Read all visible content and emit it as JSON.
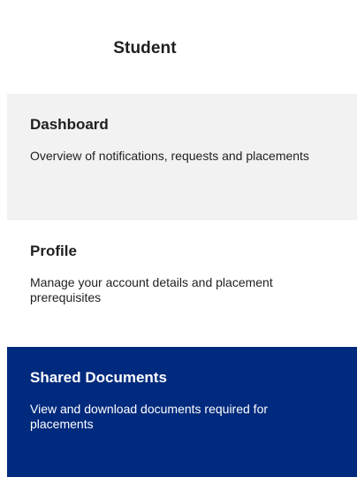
{
  "header": {
    "title": "Student"
  },
  "nav": {
    "items": [
      {
        "title": "Dashboard",
        "description": "Overview of notifications, requests and placements",
        "state": "default"
      },
      {
        "title": "Profile",
        "description": "Manage your account details and placement prerequisites",
        "state": "default"
      },
      {
        "title": "Shared Documents",
        "description": "View and download documents required for placements",
        "state": "active"
      }
    ]
  },
  "colors": {
    "active_background": "#002a7d",
    "hover_background": "#f2f2f2",
    "text_primary": "#1f1f1f",
    "text_on_active": "#ffffff"
  }
}
